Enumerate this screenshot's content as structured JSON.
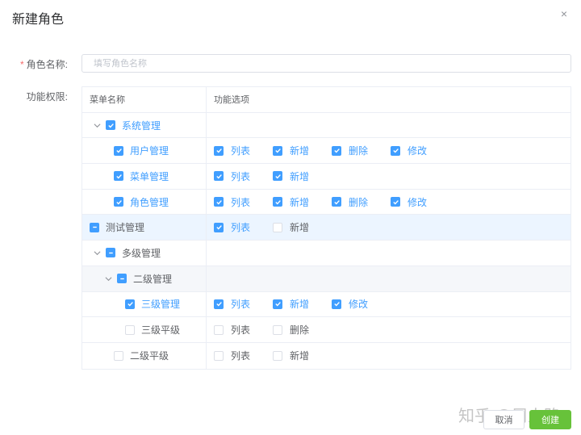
{
  "dialog": {
    "title": "新建角色",
    "close_glyph": "×"
  },
  "form": {
    "required_mark": "*",
    "name_label": "角色名称:",
    "name_placeholder": "填写角色名称",
    "name_value": "",
    "perm_label": "功能权限:"
  },
  "table": {
    "headers": {
      "name": "菜单名称",
      "options": "功能选项"
    },
    "rows": [
      {
        "label": "系统管理",
        "state": "checked",
        "options": []
      },
      {
        "label": "用户管理",
        "state": "checked",
        "options": [
          {
            "label": "列表",
            "checked": true
          },
          {
            "label": "新增",
            "checked": true
          },
          {
            "label": "删除",
            "checked": true
          },
          {
            "label": "修改",
            "checked": true
          }
        ]
      },
      {
        "label": "菜单管理",
        "state": "checked",
        "options": [
          {
            "label": "列表",
            "checked": true
          },
          {
            "label": "新增",
            "checked": true
          }
        ]
      },
      {
        "label": "角色管理",
        "state": "checked",
        "options": [
          {
            "label": "列表",
            "checked": true
          },
          {
            "label": "新增",
            "checked": true
          },
          {
            "label": "删除",
            "checked": true
          },
          {
            "label": "修改",
            "checked": true
          }
        ]
      },
      {
        "label": "测试管理",
        "state": "partial",
        "options": [
          {
            "label": "列表",
            "checked": true
          },
          {
            "label": "新增",
            "checked": false
          }
        ]
      },
      {
        "label": "多级管理",
        "state": "partial",
        "options": []
      },
      {
        "label": "二级管理",
        "state": "partial",
        "options": []
      },
      {
        "label": "三级管理",
        "state": "checked",
        "options": [
          {
            "label": "列表",
            "checked": true
          },
          {
            "label": "新增",
            "checked": true
          },
          {
            "label": "修改",
            "checked": true
          }
        ]
      },
      {
        "label": "三级平级",
        "state": "unchecked",
        "options": [
          {
            "label": "列表",
            "checked": false
          },
          {
            "label": "删除",
            "checked": false
          }
        ]
      },
      {
        "label": "二级平级",
        "state": "unchecked",
        "options": [
          {
            "label": "列表",
            "checked": false
          },
          {
            "label": "新增",
            "checked": false
          }
        ]
      }
    ]
  },
  "footer": {
    "cancel_label": "取消",
    "create_label": "创建"
  },
  "watermark": "知乎 @周人路",
  "colors": {
    "primary": "#409eff",
    "success": "#67c23a",
    "border": "#ebeef5",
    "highlight_row": "#ecf5ff",
    "danger": "#f56c6c"
  },
  "icons": {
    "close": "close-icon",
    "expand": "chevron-down-icon",
    "check": "check-icon",
    "partial": "minus-icon"
  }
}
